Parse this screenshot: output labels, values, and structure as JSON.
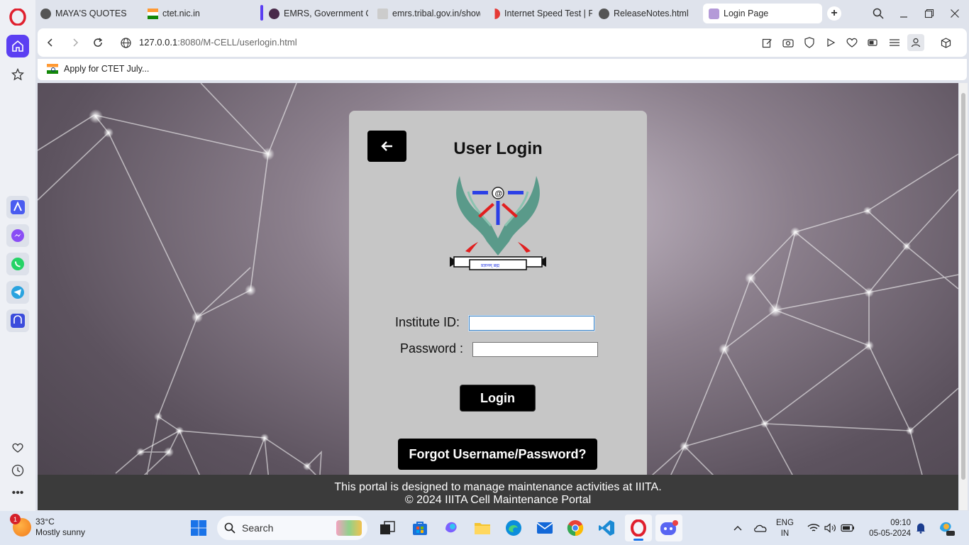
{
  "browser": {
    "tabs": [
      {
        "title": "MAYA'S QUOTES",
        "active": false
      },
      {
        "title": "ctet.nic.in",
        "active": false
      },
      {
        "title": "EMRS, Government Of",
        "active": false
      },
      {
        "title": "emrs.tribal.gov.in/show",
        "active": false
      },
      {
        "title": "Internet Speed Test | Fa",
        "active": false
      },
      {
        "title": "ReleaseNotes.html",
        "active": false
      },
      {
        "title": "Login Page",
        "active": true
      }
    ],
    "url_host": "127.0.0.1",
    "url_rest": ":8080/M-CELL/userlogin.html",
    "bookmark": "Apply for CTET July..."
  },
  "login": {
    "title": "User Login",
    "institute_label": "Institute ID:",
    "password_label": "Password :",
    "institute_value": "",
    "password_value": "",
    "login_button": "Login",
    "forgot_button": "Forgot Username/Password?",
    "logo_caption": "प्रज्ञानम् ब्रह्म"
  },
  "footer": {
    "line1": "This portal is designed to manage maintenance activities at IIITA.",
    "line2": "© 2024 IIITA Cell Maintenance Portal"
  },
  "taskbar": {
    "weather_temp": "33°C",
    "weather_desc": "Mostly sunny",
    "weather_badge": "1",
    "search_placeholder": "Search",
    "lang_line1": "ENG",
    "lang_line2": "IN",
    "time": "09:10",
    "date": "05-05-2024"
  },
  "colors": {
    "accent": "#5b3ff2",
    "card_bg": "#c6c6c6",
    "button_bg": "#000000",
    "footer_bg": "#3b3b3b"
  }
}
